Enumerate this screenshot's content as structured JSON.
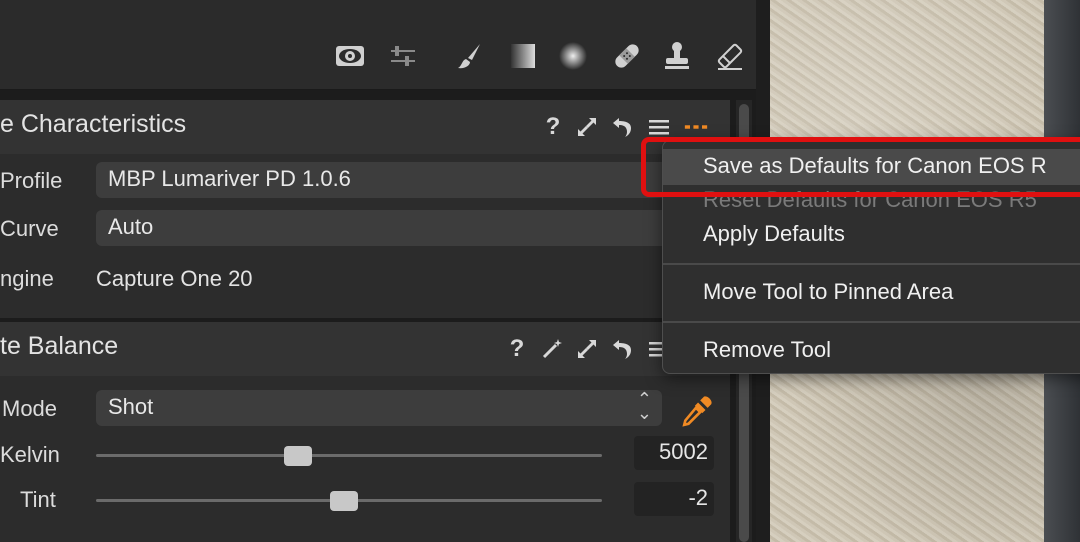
{
  "toolbar": {
    "icons": [
      "eye-icon",
      "sliders-icon",
      "brush-icon",
      "gradient-icon",
      "radial-icon",
      "healing-icon",
      "stamp-icon",
      "eraser-icon"
    ]
  },
  "base_characteristics": {
    "title": "e Characteristics",
    "header_icons": [
      "?",
      "expand-icon",
      "reset-icon",
      "menu-icon",
      "more-icon"
    ],
    "rows": [
      {
        "label": "Profile",
        "value": "MBP Lumariver PD 1.0.6"
      },
      {
        "label": "Curve",
        "value": "Auto"
      },
      {
        "label": "ngine",
        "value": "Capture One 20"
      }
    ]
  },
  "white_balance": {
    "title": "te Balance",
    "mode_label": "Mode",
    "mode_value": "Shot",
    "kelvin_label": "Kelvin",
    "kelvin_value": "5002",
    "kelvin_level": 0.4,
    "tint_label": "Tint",
    "tint_value": "-2",
    "tint_level": 0.49
  },
  "context_menu": {
    "items": [
      {
        "label": "Save as Defaults for Canon EOS R",
        "state": "highlighted"
      },
      {
        "label": "Reset Defaults for Canon EOS R5",
        "state": "disabled"
      },
      {
        "label": "Apply Defaults",
        "state": "normal"
      },
      {
        "label": "Move Tool to Pinned Area",
        "state": "normal"
      },
      {
        "label": "Remove Tool",
        "state": "normal"
      }
    ]
  },
  "colors": {
    "accent_orange": "#f08a24",
    "highlight_red": "#e01010"
  }
}
